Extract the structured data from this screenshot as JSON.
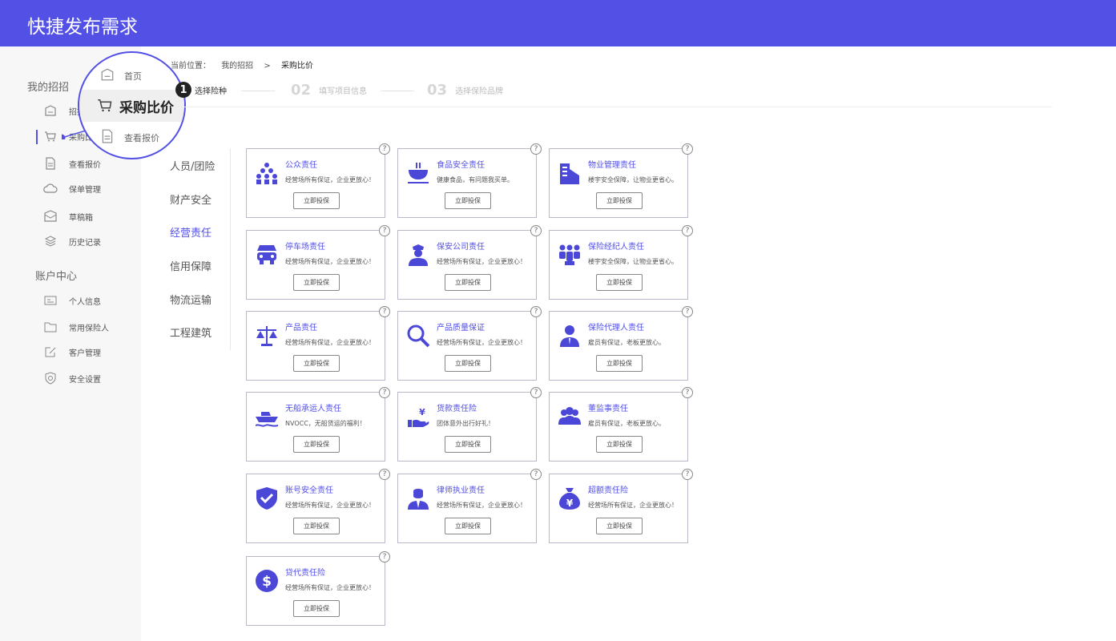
{
  "header": {
    "title": "快捷发布需求"
  },
  "sidebar": {
    "section1": "我的招招",
    "section2": "账户中心",
    "items": [
      {
        "label": "招招首页",
        "icon": "home-icon"
      },
      {
        "label": "采购比价",
        "icon": "cart-icon"
      },
      {
        "label": "查看报价",
        "icon": "document-icon"
      },
      {
        "label": "保单管理",
        "icon": "cloud-icon"
      },
      {
        "label": "草稿箱",
        "icon": "inbox-icon"
      },
      {
        "label": "历史记录",
        "icon": "layers-icon"
      },
      {
        "label": "个人信息",
        "icon": "id-card-icon"
      },
      {
        "label": "常用保险人",
        "icon": "folder-icon"
      },
      {
        "label": "客户管理",
        "icon": "edit-icon"
      },
      {
        "label": "安全设置",
        "icon": "shield-icon"
      }
    ]
  },
  "zoom": {
    "item1": "首页",
    "item2": "采购比价",
    "item3": "查看报价"
  },
  "breadcrumb": {
    "prefix": "当前位置：",
    "level1": "我的招招",
    "sep": ">",
    "level2": "采购比价"
  },
  "steps": [
    {
      "num": "1",
      "label": "选择险种"
    },
    {
      "num": "02",
      "label": "填写项目信息"
    },
    {
      "num": "03",
      "label": "选择保险品牌"
    }
  ],
  "categories": [
    "人员/团险",
    "财产安全",
    "经营责任",
    "信用保障",
    "物流运输",
    "工程建筑"
  ],
  "active_category": "经营责任",
  "colors": {
    "brand": "#5350e6",
    "icon": "#4b48d8"
  },
  "cards": [
    {
      "title": "公众责任",
      "desc": "经营场所有保证，企业更放心！",
      "button": "立即投保",
      "icon": "crowd-icon"
    },
    {
      "title": "食品安全责任",
      "desc": "健康食品，有问题我买单。",
      "button": "立即投保",
      "icon": "food-bowl-icon"
    },
    {
      "title": "物业管理责任",
      "desc": "楼宇安全保障，让物业更省心。",
      "button": "立即投保",
      "icon": "building-icon"
    },
    {
      "title": "停车场责任",
      "desc": "经营场所有保证，企业更放心！",
      "button": "立即投保",
      "icon": "car-icon"
    },
    {
      "title": "保安公司责任",
      "desc": "经营场所有保证，企业更放心！",
      "button": "立即投保",
      "icon": "guard-icon"
    },
    {
      "title": "保险经纪人责任",
      "desc": "楼宇安全保障，让物业更省心。",
      "button": "立即投保",
      "icon": "team-icon"
    },
    {
      "title": "产品责任",
      "desc": "经营场所有保证，企业更放心！",
      "button": "立即投保",
      "icon": "scale-icon"
    },
    {
      "title": "产品质量保证",
      "desc": "经营场所有保证，企业更放心！",
      "button": "立即投保",
      "icon": "magnifier-icon"
    },
    {
      "title": "保险代理人责任",
      "desc": "雇员有保证，老板更放心。",
      "button": "立即投保",
      "icon": "agent-icon"
    },
    {
      "title": "无船承运人责任",
      "desc": "NVOCC，无船货运的福利！",
      "button": "立即投保",
      "icon": "ship-icon"
    },
    {
      "title": "货款责任险",
      "desc": "团体意外出行好礼！",
      "button": "立即投保",
      "icon": "money-hand-icon"
    },
    {
      "title": "董监事责任",
      "desc": "雇员有保证，老板更放心。",
      "button": "立即投保",
      "icon": "board-icon"
    },
    {
      "title": "账号安全责任",
      "desc": "经营场所有保证，企业更放心！",
      "button": "立即投保",
      "icon": "shield-check-icon"
    },
    {
      "title": "律师执业责任",
      "desc": "经营场所有保证，企业更放心！",
      "button": "立即投保",
      "icon": "lawyer-icon"
    },
    {
      "title": "超额责任险",
      "desc": "经营场所有保证，企业更放心！",
      "button": "立即投保",
      "icon": "money-bag-icon"
    },
    {
      "title": "贷代责任险",
      "desc": "经营场所有保证，企业更放心！",
      "button": "立即投保",
      "icon": "dollar-coin-icon"
    }
  ],
  "help_glyph": "?"
}
